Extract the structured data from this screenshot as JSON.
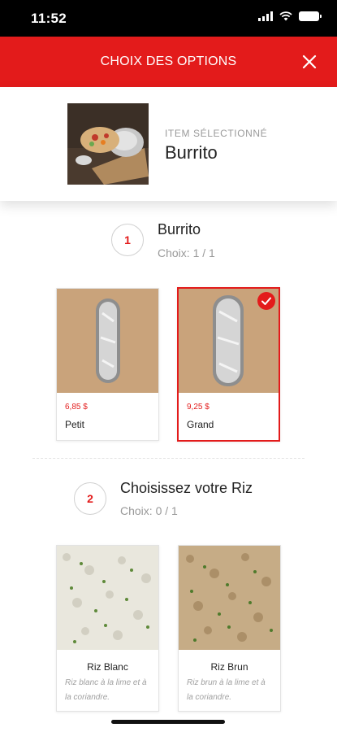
{
  "status": {
    "time": "11:52"
  },
  "header": {
    "title": "CHOIX DES OPTIONS",
    "close_icon": "close-icon"
  },
  "selected_item": {
    "caption": "ITEM SÉLECTIONNÉ",
    "name": "Burrito"
  },
  "sections": [
    {
      "number": "1",
      "title": "Burrito",
      "subtitle": "Choix: 1 / 1",
      "options": [
        {
          "price": "6,85 $",
          "name": "Petit",
          "selected": false
        },
        {
          "price": "9,25 $",
          "name": "Grand",
          "selected": true
        }
      ]
    },
    {
      "number": "2",
      "title": "Choisissez votre Riz",
      "subtitle": "Choix: 0 / 1",
      "options": [
        {
          "name": "Riz Blanc",
          "description": "Riz blanc à la lime et à la coriandre."
        },
        {
          "name": "Riz Brun",
          "description": "Riz brun à la lime et à la coriandre."
        }
      ]
    }
  ],
  "colors": {
    "accent": "#e31b1b",
    "status_bar": "#000000",
    "muted_text": "#999999"
  }
}
